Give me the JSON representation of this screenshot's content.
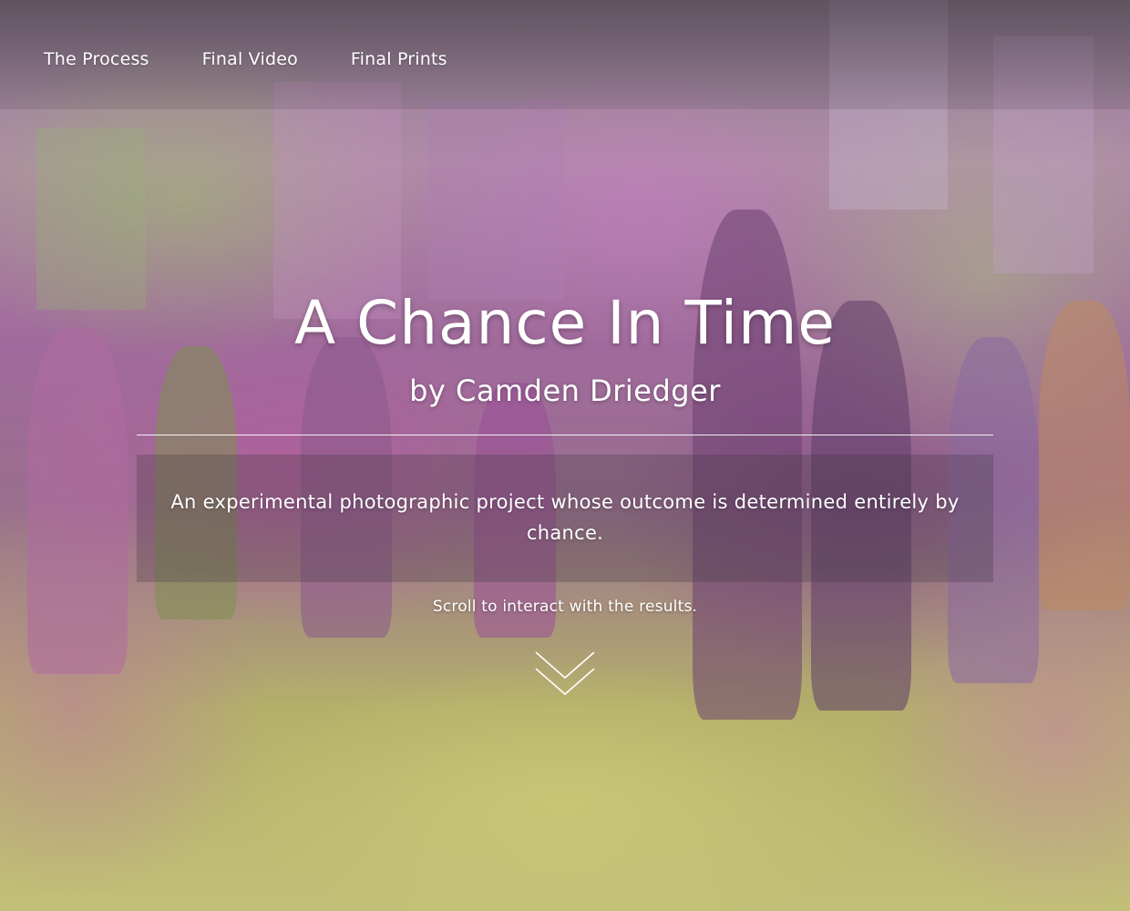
{
  "nav": {
    "items": [
      {
        "label": "The Process"
      },
      {
        "label": "Final Video"
      },
      {
        "label": "Final Prints"
      }
    ]
  },
  "hero": {
    "title": "A Chance In Time",
    "byline": "by Camden Driedger",
    "description": "An experimental photographic project whose outcome is determined entirely by chance.",
    "scroll_prompt": "Scroll to interact with the results."
  },
  "icons": {
    "scroll_arrow": "double-chevron-down-icon"
  },
  "colors": {
    "text": "#ffffff",
    "tint_magenta": "#b060a8",
    "tint_green": "#b8c070"
  }
}
